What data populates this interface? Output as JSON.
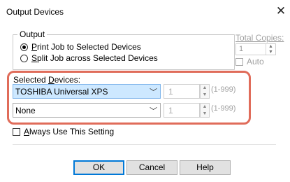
{
  "window": {
    "title": "Output Devices",
    "close_glyph": "✕"
  },
  "output_group": {
    "label": "Output",
    "options": [
      {
        "prefix": "",
        "accel": "P",
        "rest": "rint Job to Selected Devices",
        "selected": true
      },
      {
        "prefix": "",
        "accel": "S",
        "rest": "plit Job across Selected Devices",
        "selected": false
      }
    ]
  },
  "total_copies": {
    "label": "Total Copies:",
    "value": "1",
    "auto_label": "Auto",
    "auto_checked": false
  },
  "selected_devices": {
    "label_prefix": "Selected ",
    "label_accel": "D",
    "label_rest": "evices:",
    "rows": [
      {
        "device": "TOSHIBA Universal XPS",
        "copies": "1",
        "range": "(1-999)"
      },
      {
        "device": "None",
        "copies": "1",
        "range": "(1-999)"
      }
    ]
  },
  "always_use": {
    "accel": "A",
    "rest": "lways Use This Setting",
    "checked": false
  },
  "buttons": {
    "ok": "OK",
    "cancel": "Cancel",
    "help": "Help"
  },
  "colors": {
    "highlight": "#e06c5a",
    "selection": "#cde8ff",
    "default_button_border": "#0078d7"
  },
  "icons": {
    "spin_up": "▲",
    "spin_down": "▼",
    "dropdown": "﹀"
  }
}
